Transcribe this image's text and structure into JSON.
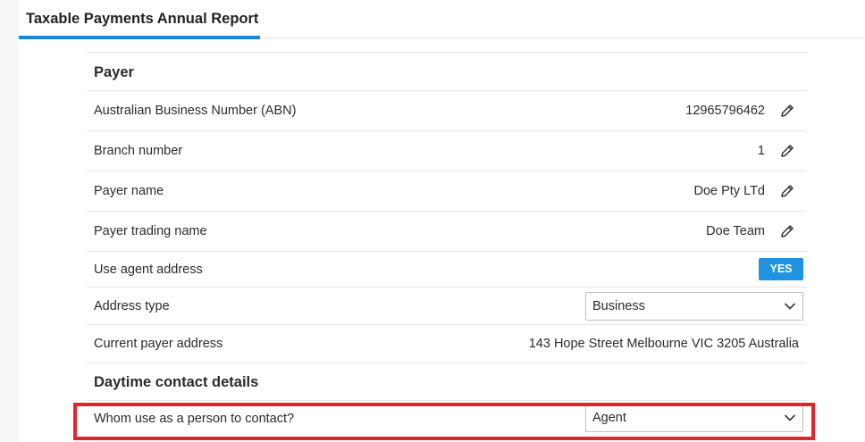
{
  "tab": {
    "title": "Taxable Payments Annual Report"
  },
  "payer": {
    "section_title": "Payer",
    "abn": {
      "label": "Australian Business Number (ABN)",
      "value": "12965796462"
    },
    "branch": {
      "label": "Branch number",
      "value": "1"
    },
    "name": {
      "label": "Payer name",
      "value": "Doe Pty LTd"
    },
    "trading_name": {
      "label": "Payer trading name",
      "value": "Doe Team"
    },
    "use_agent_address": {
      "label": "Use agent address",
      "value": "YES"
    },
    "address_type": {
      "label": "Address type",
      "selected": "Business"
    },
    "current_address": {
      "label": "Current payer address",
      "value": "143 Hope Street Melbourne VIC 3205 Australia"
    }
  },
  "contact": {
    "section_title": "Daytime contact details",
    "person": {
      "label": "Whom use as a person to contact?",
      "selected": "Agent"
    }
  },
  "colors": {
    "accent": "#1f86d6",
    "toggle": "#1f93e0",
    "highlight": "#e0262d"
  },
  "icons": {
    "edit": "pencil-icon",
    "dropdown": "chevron-down-icon"
  }
}
